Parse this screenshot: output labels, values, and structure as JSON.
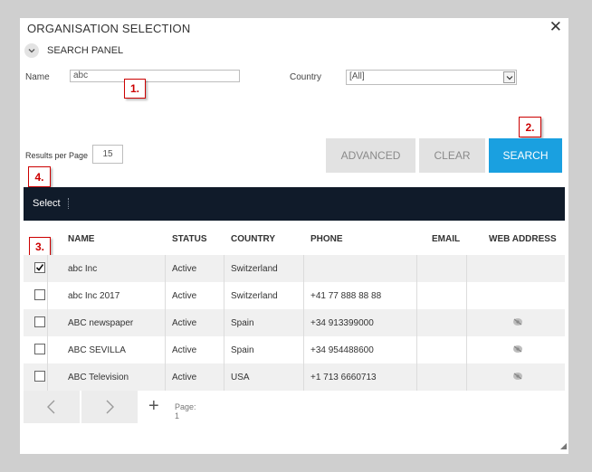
{
  "dialog": {
    "title": "ORGANISATION SELECTION"
  },
  "search_panel": {
    "label": "SEARCH PANEL",
    "name_label": "Name",
    "name_value": "abc",
    "country_label": "Country",
    "country_value": "[All]"
  },
  "markers": [
    "1.",
    "2.",
    "3.",
    "4."
  ],
  "buttons": {
    "advanced": "ADVANCED",
    "clear": "CLEAR",
    "search": "SEARCH"
  },
  "results_per_page": {
    "label": "Results per Page",
    "value": "15"
  },
  "toolbar": {
    "select_label": "Select"
  },
  "table": {
    "headers": {
      "name": "NAME",
      "status": "STATUS",
      "country": "COUNTRY",
      "phone": "PHONE",
      "email": "EMAIL",
      "web": "WEB ADDRESS"
    },
    "rows": [
      {
        "checked": true,
        "name": "abc Inc",
        "status": "Active",
        "country": "Switzerland",
        "phone": "",
        "email": "",
        "web": false
      },
      {
        "checked": false,
        "name": "abc Inc 2017",
        "status": "Active",
        "country": "Switzerland",
        "phone": "+41 77 888 88 88",
        "email": "",
        "web": false
      },
      {
        "checked": false,
        "name": "ABC newspaper",
        "status": "Active",
        "country": "Spain",
        "phone": "+34 913399000",
        "email": "",
        "web": true
      },
      {
        "checked": false,
        "name": "ABC SEVILLA",
        "status": "Active",
        "country": "Spain",
        "phone": "+34 954488600",
        "email": "",
        "web": true
      },
      {
        "checked": false,
        "name": "ABC Television",
        "status": "Active",
        "country": "USA",
        "phone": "+1 713 6660713",
        "email": "",
        "web": true
      }
    ]
  },
  "pager": {
    "page_label": "Page: 1"
  },
  "colors": {
    "accent": "#1aa0e0",
    "toolbar": "#101b2a",
    "marker": "#cc0000"
  }
}
